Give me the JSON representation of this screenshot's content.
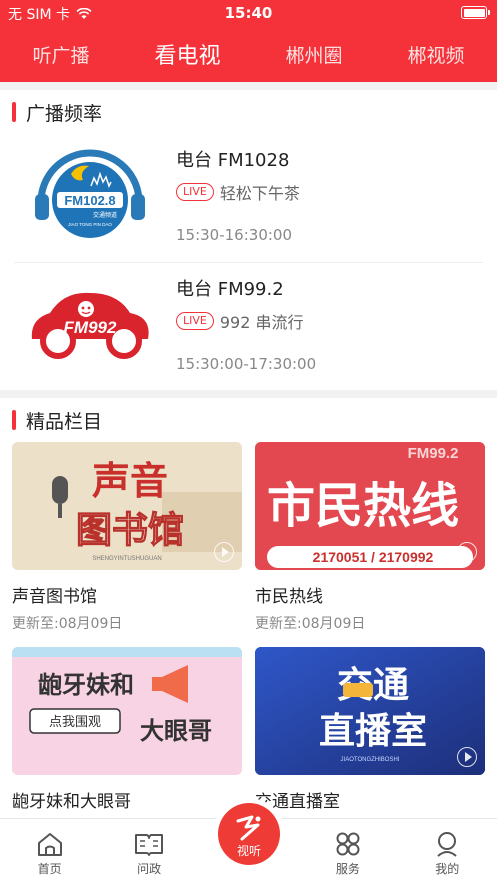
{
  "status": {
    "carrier": "无 SIM 卡",
    "time": "15:40"
  },
  "nav": {
    "tabs": [
      "听广播",
      "看电视",
      "郴州圈",
      "郴视频"
    ],
    "active_index": 1
  },
  "broadcast": {
    "section_title": "广播频率",
    "stations": [
      {
        "name": "电台 FM1028",
        "live": "LIVE",
        "program": "轻松下午茶",
        "time": "15:30-16:30:00",
        "logo_text": "FM102.8",
        "logo_sub": "交通频道",
        "logo_pinyin": "JIAO TONG PIN DAO"
      },
      {
        "name": "电台 FM99.2",
        "live": "LIVE",
        "program": "992 串流行",
        "time": "15:30:00-17:30:00",
        "logo_text": "FM992"
      }
    ]
  },
  "premium": {
    "section_title": "精品栏目",
    "columns": [
      {
        "title": "声音图书馆",
        "sub": "更新至:08月09日",
        "thumb_lines": [
          "声音",
          "图书馆"
        ],
        "thumb_caption": "SHENGYINTUSHUGUAN"
      },
      {
        "title": "市民热线",
        "sub": "更新至:08月09日",
        "thumb_lines": [
          "市民热线"
        ],
        "thumb_tag": "FM99.2",
        "thumb_phone": "2170051 / 2170992"
      },
      {
        "title": "龅牙妹和大眼哥",
        "sub": "",
        "thumb_lines": [
          "龅牙妹和",
          "大眼哥"
        ],
        "thumb_tag": "点我围观"
      },
      {
        "title": "交通直播室",
        "sub": "",
        "thumb_lines": [
          "交通",
          "直播室"
        ],
        "thumb_caption": "JIAOTONGZHIBOSHI"
      }
    ]
  },
  "tabbar": {
    "items": [
      "首页",
      "问政",
      "视听",
      "服务",
      "我的"
    ]
  },
  "colors": {
    "brand": "#f5323a"
  }
}
